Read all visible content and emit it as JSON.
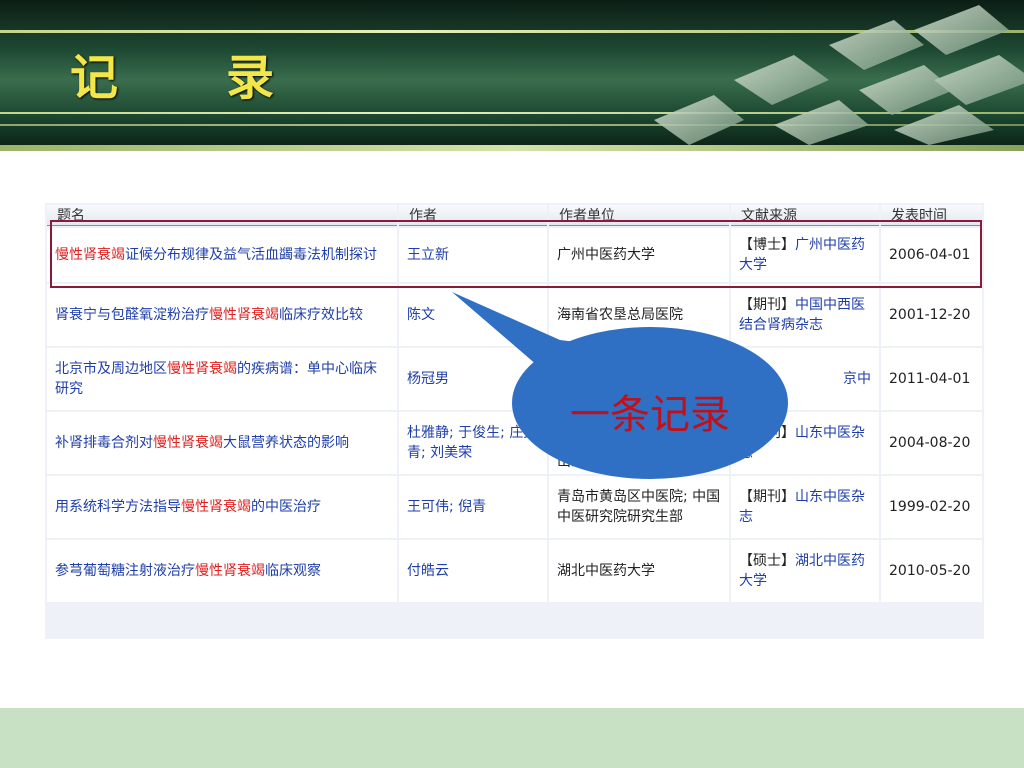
{
  "slide": {
    "title": "记　录",
    "callout": "一条记录"
  },
  "table": {
    "headers": [
      "题名",
      "作者",
      "作者单位",
      "文献来源",
      "发表时间"
    ],
    "rows": [
      {
        "title_hl": "慢性肾衰竭",
        "title_rest": "证候分布规律及益气活血蠲毒法机制探讨",
        "title_pre": "",
        "author": "王立新",
        "unit": "广州中医药大学",
        "src_tag": "【博士】",
        "src_name": "广州中医药大学",
        "date": "2006-04-01"
      },
      {
        "title_pre": "肾衰宁与包醛氧淀粉治疗",
        "title_hl": "慢性肾衰竭",
        "title_rest": "临床疗效比较",
        "author": "陈文",
        "unit": "海南省农垦总局医院",
        "src_tag": "【期刊】",
        "src_name": "中国中西医结合肾病杂志",
        "date": "2001-12-20"
      },
      {
        "title_pre": "北京市及周边地区",
        "title_hl": "慢性肾衰竭",
        "title_rest": "的疾病谱：单中心临床研究",
        "author": "杨冠男",
        "unit": "",
        "src_tag": "",
        "src_name": "京中",
        "date": "2011-04-01"
      },
      {
        "title_pre": "补肾排毒合剂对",
        "title_hl": "慢性肾衰竭",
        "title_rest": "大鼠营养状态的影响",
        "author": "杜雅静; 于俊生; 庄文青; 刘美荣",
        "unit": "岛市中医医院; 山东青岛; 山东青岛",
        "src_tag": "【期刊】",
        "src_name": "山东中医杂志",
        "date": "2004-08-20"
      },
      {
        "title_pre": "用系统科学方法指导",
        "title_hl": "慢性肾衰竭",
        "title_rest": "的中医治疗",
        "author": "王可伟; 倪青",
        "unit": "青岛市黄岛区中医院; 中国中医研究院研究生部",
        "src_tag": "【期刊】",
        "src_name": "山东中医杂志",
        "date": "1999-02-20"
      },
      {
        "title_pre": "参芎葡萄糖注射液治疗",
        "title_hl": "慢性肾衰竭",
        "title_rest": "临床观察",
        "author": "付皓云",
        "unit": "湖北中医药大学",
        "src_tag": "【硕士】",
        "src_name": "湖北中医药大学",
        "date": "2010-05-20"
      }
    ]
  },
  "colors": {
    "highlight": "#e02020",
    "link": "#1f3fa8",
    "selection": "#8b1a3a",
    "callout_fill": "#2f6fc4"
  }
}
